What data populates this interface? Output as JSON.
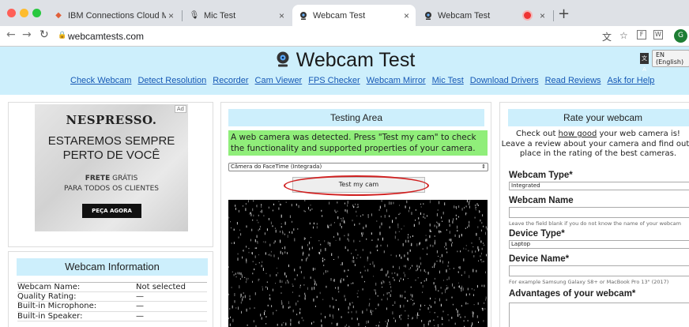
{
  "browser": {
    "tabs": [
      {
        "title": "IBM Connections Cloud Meeti",
        "icon": "ibm-favicon"
      },
      {
        "title": "Mic Test",
        "icon": "mic-favicon"
      },
      {
        "title": "Webcam Test",
        "icon": "webcam-favicon"
      },
      {
        "title": "Webcam Test",
        "icon": "webcam-favicon"
      }
    ],
    "url": "webcamtests.com",
    "profile_initial": "G"
  },
  "header": {
    "title": "Webcam Test",
    "language": "EN (English)",
    "nav": [
      "Check Webcam",
      "Detect Resolution",
      "Recorder",
      "Cam Viewer",
      "FPS Checker",
      "Webcam Mirror",
      "Mic Test",
      "Download Drivers",
      "Read Reviews",
      "Ask for Help"
    ]
  },
  "ad": {
    "badge": "Ad",
    "brand": "NESPRESSO.",
    "headline_1": "ESTAREMOS SEMPRE",
    "headline_2": "PERTO DE VOCÊ",
    "sub_bold": "FRETE",
    "sub_rest": "GRÁTIS",
    "sub_2": "PARA TODOS OS CLIENTES",
    "cta": "PEÇA AGORA"
  },
  "info": {
    "title": "Webcam Information",
    "rows": [
      {
        "k": "Webcam Name:",
        "v": "Not selected"
      },
      {
        "k": "Quality Rating:",
        "v": "—"
      },
      {
        "k": "Built-in Microphone:",
        "v": "—"
      },
      {
        "k": "Built-in Speaker:",
        "v": "—"
      }
    ]
  },
  "testing": {
    "title": "Testing Area",
    "message": "A web camera was detected. Press \"Test my cam\" to check the functionality and supported properties of your camera.",
    "camera_select": "Câmera do FaceTime (Integrada)",
    "button": "Test my cam"
  },
  "rate": {
    "title": "Rate your webcam",
    "intro_a": "Check out ",
    "intro_link": "how good",
    "intro_b": " your web camera is!",
    "intro_2": "Leave a review about your camera and find out t",
    "intro_3": "place in the rating of the best cameras.",
    "type_label": "Webcam Type*",
    "type_value": "Integrated",
    "name_label": "Webcam Name",
    "name_hint": "Leave the field blank if you do not know the name of your webcam",
    "device_type_label": "Device Type*",
    "device_type_value": "Laptop",
    "device_name_label": "Device Name*",
    "device_name_hint": "For example Samsung Galaxy S8+ or MacBook Pro 13\" (2017)",
    "advantages_label": "Advantages of your webcam*"
  },
  "colors": {
    "accent_bg": "#cdeffc",
    "link": "#1558b5",
    "success": "#90ee7a",
    "highlight": "#d02020"
  }
}
